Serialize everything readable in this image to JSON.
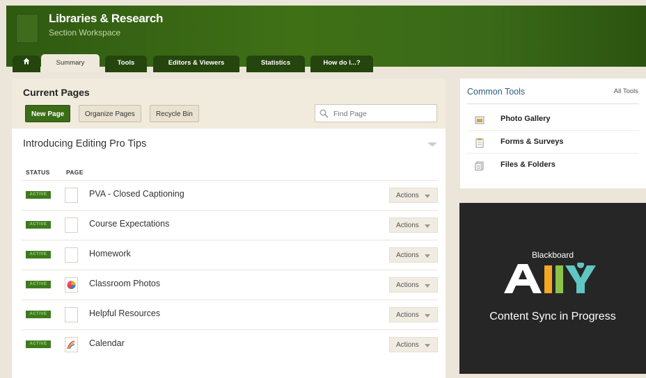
{
  "header": {
    "title": "Libraries & Research",
    "subtitle": "Section Workspace"
  },
  "tabs": [
    {
      "label": "Summary",
      "active": true
    },
    {
      "label": "Tools"
    },
    {
      "label": "Editors & Viewers"
    },
    {
      "label": "Statistics"
    },
    {
      "label": "How do I...?"
    }
  ],
  "main": {
    "title": "Current Pages",
    "buttons": {
      "new": "New Page",
      "organize": "Organize Pages",
      "recycle": "Recycle Bin"
    },
    "search_placeholder": "Find Page",
    "section_title": "Introducing Editing Pro Tips",
    "columns": {
      "status": "STATUS",
      "page": "PAGE"
    },
    "rows": [
      {
        "status": "ACTIVE",
        "title": "PVA - Closed Captioning",
        "icon": "blank-page-icon",
        "actions": "Actions"
      },
      {
        "status": "ACTIVE",
        "title": "Course Expectations",
        "icon": "blank-page-icon",
        "actions": "Actions"
      },
      {
        "status": "ACTIVE",
        "title": "Homework",
        "icon": "blank-page-icon",
        "actions": "Actions"
      },
      {
        "status": "ACTIVE",
        "title": "Classroom Photos",
        "icon": "photo-gallery-icon",
        "actions": "Actions"
      },
      {
        "status": "ACTIVE",
        "title": "Helpful Resources",
        "icon": "blank-page-icon",
        "actions": "Actions"
      },
      {
        "status": "ACTIVE",
        "title": "Calendar",
        "icon": "calendar-icon",
        "actions": "Actions"
      }
    ]
  },
  "common_tools": {
    "title": "Common Tools",
    "all_link": "All Tools",
    "items": [
      {
        "label": "Photo Gallery",
        "icon": "photo-gallery-icon"
      },
      {
        "label": "Forms & Surveys",
        "icon": "forms-icon"
      },
      {
        "label": "Files & Folders",
        "icon": "files-icon"
      }
    ]
  },
  "ally": {
    "brand": "Blackboard",
    "status": "Content Sync in Progress"
  },
  "colors": {
    "brand_green": "#3b6c16",
    "ally_yellow": "#f5a623",
    "ally_teal": "#5fc6c1",
    "ally_green": "#8bc34a"
  }
}
